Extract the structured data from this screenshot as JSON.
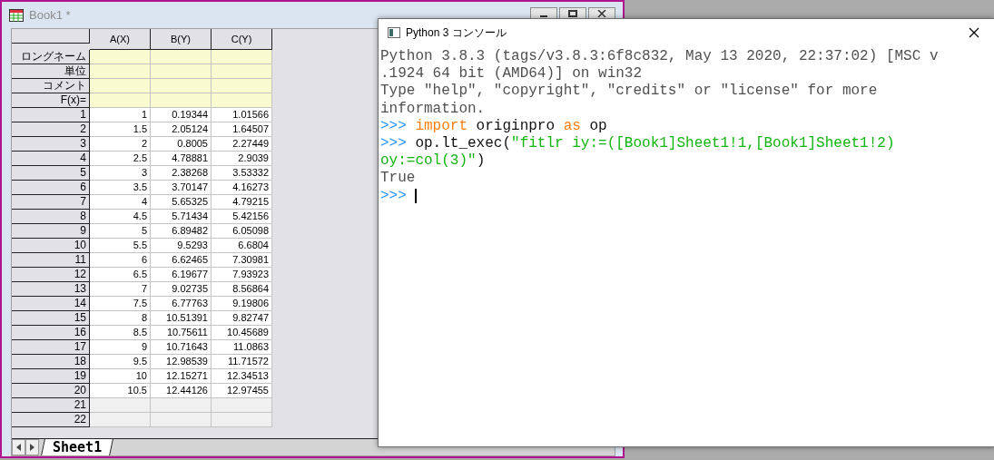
{
  "book_window": {
    "title": "Book1 *",
    "columns": [
      "A(X)",
      "B(Y)",
      "C(Y)"
    ],
    "label_rows": [
      "ロングネーム",
      "単位",
      "コメント",
      "F(x)="
    ],
    "rows": [
      {
        "number": "1",
        "cells": [
          "1",
          "0.19344",
          "1.01566"
        ]
      },
      {
        "number": "2",
        "cells": [
          "1.5",
          "2.05124",
          "1.64507"
        ]
      },
      {
        "number": "3",
        "cells": [
          "2",
          "0.8005",
          "2.27449"
        ]
      },
      {
        "number": "4",
        "cells": [
          "2.5",
          "4.78881",
          "2.9039"
        ]
      },
      {
        "number": "5",
        "cells": [
          "3",
          "2.38268",
          "3.53332"
        ]
      },
      {
        "number": "6",
        "cells": [
          "3.5",
          "3.70147",
          "4.16273"
        ]
      },
      {
        "number": "7",
        "cells": [
          "4",
          "5.65325",
          "4.79215"
        ]
      },
      {
        "number": "8",
        "cells": [
          "4.5",
          "5.71434",
          "5.42156"
        ]
      },
      {
        "number": "9",
        "cells": [
          "5",
          "6.89482",
          "6.05098"
        ]
      },
      {
        "number": "10",
        "cells": [
          "5.5",
          "9.5293",
          "6.6804"
        ]
      },
      {
        "number": "11",
        "cells": [
          "6",
          "6.62465",
          "7.30981"
        ]
      },
      {
        "number": "12",
        "cells": [
          "6.5",
          "6.19677",
          "7.93923"
        ]
      },
      {
        "number": "13",
        "cells": [
          "7",
          "9.02735",
          "8.56864"
        ]
      },
      {
        "number": "14",
        "cells": [
          "7.5",
          "6.77763",
          "9.19806"
        ]
      },
      {
        "number": "15",
        "cells": [
          "8",
          "10.51391",
          "9.82747"
        ]
      },
      {
        "number": "16",
        "cells": [
          "8.5",
          "10.75611",
          "10.45689"
        ]
      },
      {
        "number": "17",
        "cells": [
          "9",
          "10.71643",
          "11.0863"
        ]
      },
      {
        "number": "18",
        "cells": [
          "9.5",
          "12.98539",
          "11.71572"
        ]
      },
      {
        "number": "19",
        "cells": [
          "10",
          "12.15271",
          "12.34513"
        ]
      },
      {
        "number": "20",
        "cells": [
          "10.5",
          "12.44126",
          "12.97455"
        ]
      }
    ],
    "empty_rows": [
      "21",
      "22"
    ],
    "sheet_tabs": [
      {
        "label": "Sheet1",
        "selected": true
      }
    ]
  },
  "console": {
    "title": "Python 3 コンソール",
    "lines": [
      [
        {
          "kind": "plain",
          "text": "Python 3.8.3 (tags/v3.8.3:6f8c832, May 13 2020, 22:37:02) [MSC v"
        }
      ],
      [
        {
          "kind": "plain",
          "text": ".1924 64 bit (AMD64)] on win32"
        }
      ],
      [
        {
          "kind": "plain",
          "text": "Type \"help\", \"copyright\", \"credits\" or \"license\" for more"
        }
      ],
      [
        {
          "kind": "plain",
          "text": "information."
        }
      ],
      [
        {
          "kind": "prompt",
          "text": ">>> "
        },
        {
          "kind": "keyword",
          "text": "import"
        },
        {
          "kind": "code",
          "text": " originpro "
        },
        {
          "kind": "keyword",
          "text": "as"
        },
        {
          "kind": "code",
          "text": " op"
        }
      ],
      [
        {
          "kind": "prompt",
          "text": ">>> "
        },
        {
          "kind": "code",
          "text": "op.lt_exec("
        },
        {
          "kind": "string",
          "text": "\"fitlr iy:=([Book1]Sheet1!1,[Book1]Sheet1!2)"
        }
      ],
      [
        {
          "kind": "string",
          "text": "oy:=col(3)\""
        },
        {
          "kind": "code",
          "text": ")"
        }
      ],
      [
        {
          "kind": "plain",
          "text": "True"
        }
      ],
      [
        {
          "kind": "prompt",
          "text": ">>> "
        },
        {
          "kind": "cursor"
        }
      ]
    ]
  }
}
